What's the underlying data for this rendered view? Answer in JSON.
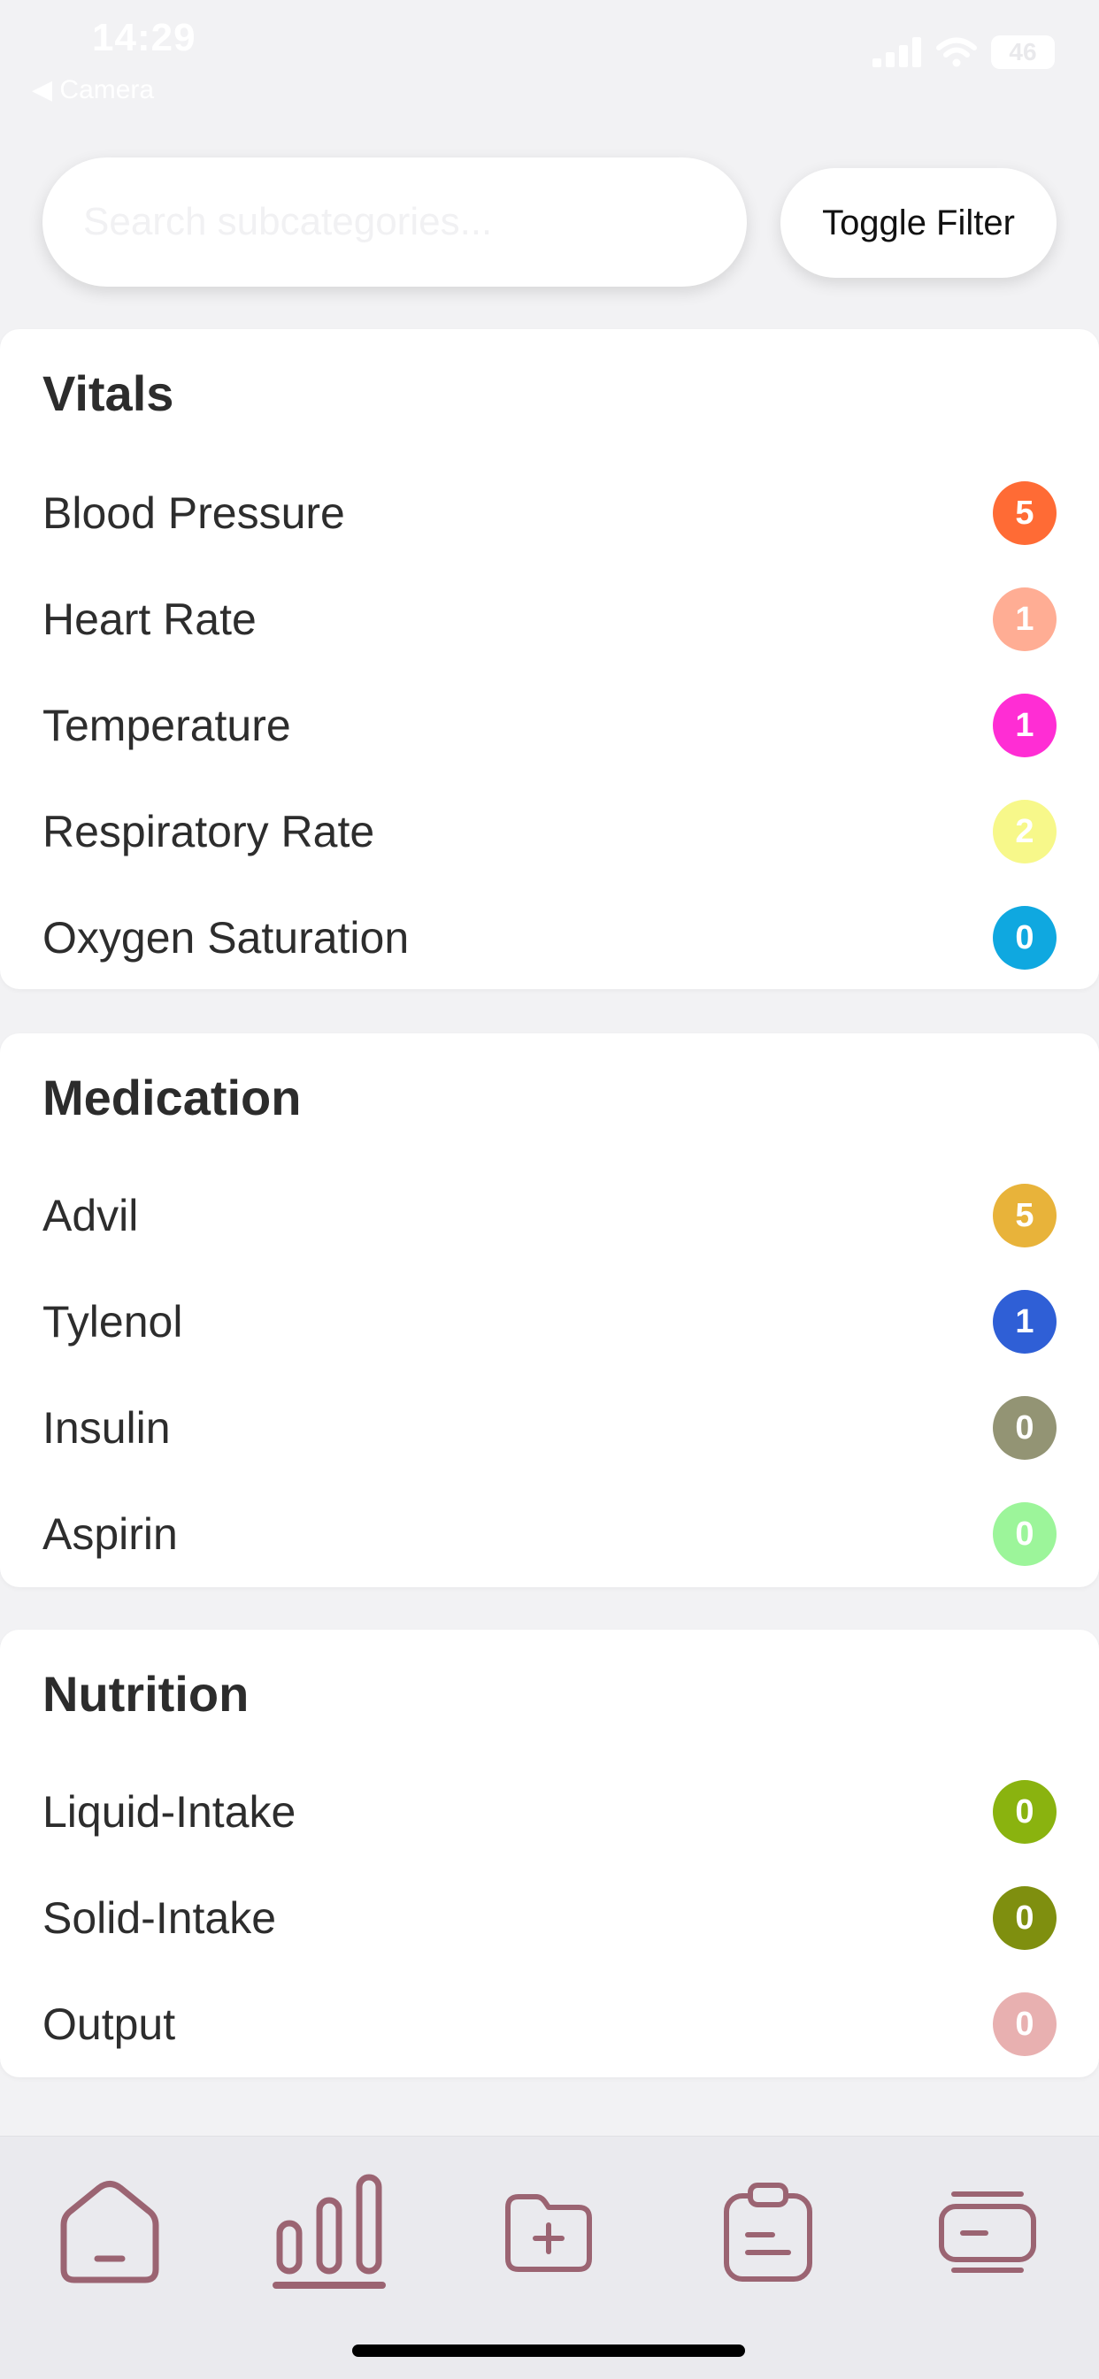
{
  "status_bar": {
    "time": "14:29",
    "back_label": "◀ Camera",
    "battery": "46"
  },
  "search": {
    "placeholder": "Search subcategories...",
    "value": ""
  },
  "toggle_filter_label": "Toggle Filter",
  "sections": [
    {
      "title": "Vitals",
      "items": [
        {
          "label": "Blood Pressure",
          "count": "5",
          "color": "#ff6b35"
        },
        {
          "label": "Heart Rate",
          "count": "1",
          "color": "#ffad94"
        },
        {
          "label": "Temperature",
          "count": "1",
          "color": "#ff2dd4"
        },
        {
          "label": "Respiratory Rate",
          "count": "2",
          "color": "#f7f88a"
        },
        {
          "label": "Oxygen Saturation",
          "count": "0",
          "color": "#0fa8e0"
        }
      ]
    },
    {
      "title": "Medication",
      "items": [
        {
          "label": "Advil",
          "count": "5",
          "color": "#e8b33a"
        },
        {
          "label": "Tylenol",
          "count": "1",
          "color": "#2f5fd6"
        },
        {
          "label": "Insulin",
          "count": "0",
          "color": "#939474"
        },
        {
          "label": "Aspirin",
          "count": "0",
          "color": "#9cf59a"
        }
      ]
    },
    {
      "title": "Nutrition",
      "items": [
        {
          "label": "Liquid-Intake",
          "count": "0",
          "color": "#8ab30f"
        },
        {
          "label": "Solid-Intake",
          "count": "0",
          "color": "#7f8f0f"
        },
        {
          "label": "Output",
          "count": "0",
          "color": "#e8b0b0"
        }
      ]
    }
  ],
  "tabbar": {
    "icon_color": "#9b6472",
    "tabs": [
      {
        "icon": "home-icon",
        "active": false
      },
      {
        "icon": "bar-chart-icon",
        "active": true
      },
      {
        "icon": "folder-add-icon",
        "active": false
      },
      {
        "icon": "clipboard-icon",
        "active": false
      },
      {
        "icon": "card-icon",
        "active": false
      }
    ]
  }
}
